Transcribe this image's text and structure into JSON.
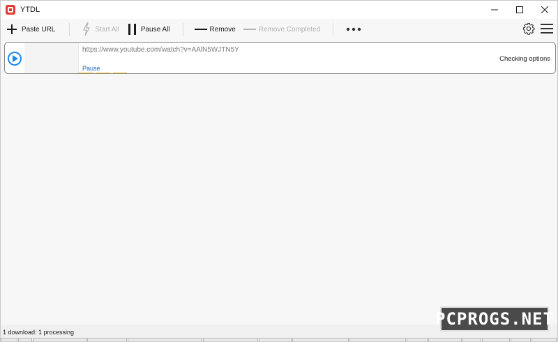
{
  "window": {
    "title": "YTDL",
    "controls": {
      "minimize": "minimize-icon",
      "maximize": "maximize-icon",
      "close": "close-icon"
    }
  },
  "toolbar": {
    "paste_url": "Paste URL",
    "start_all": "Start All",
    "pause_all": "Pause All",
    "remove": "Remove",
    "remove_completed": "Remove Completed",
    "more_icon": "more-horizontal-icon",
    "settings_icon": "gear-icon",
    "menu_icon": "hamburger-menu-icon"
  },
  "downloads": [
    {
      "url": "https://www.youtube.com/watch?v=AAlN5WJTN5Y",
      "action": "Pause",
      "status": "Checking options",
      "progress_color": "#f6c026"
    }
  ],
  "statusbar": {
    "text": "1 download: 1 processing"
  },
  "watermark": {
    "text": "PCPROGS.NET"
  },
  "colors": {
    "accent": "#1e88e5",
    "app_icon": "#e53935",
    "link": "#1565c0"
  }
}
